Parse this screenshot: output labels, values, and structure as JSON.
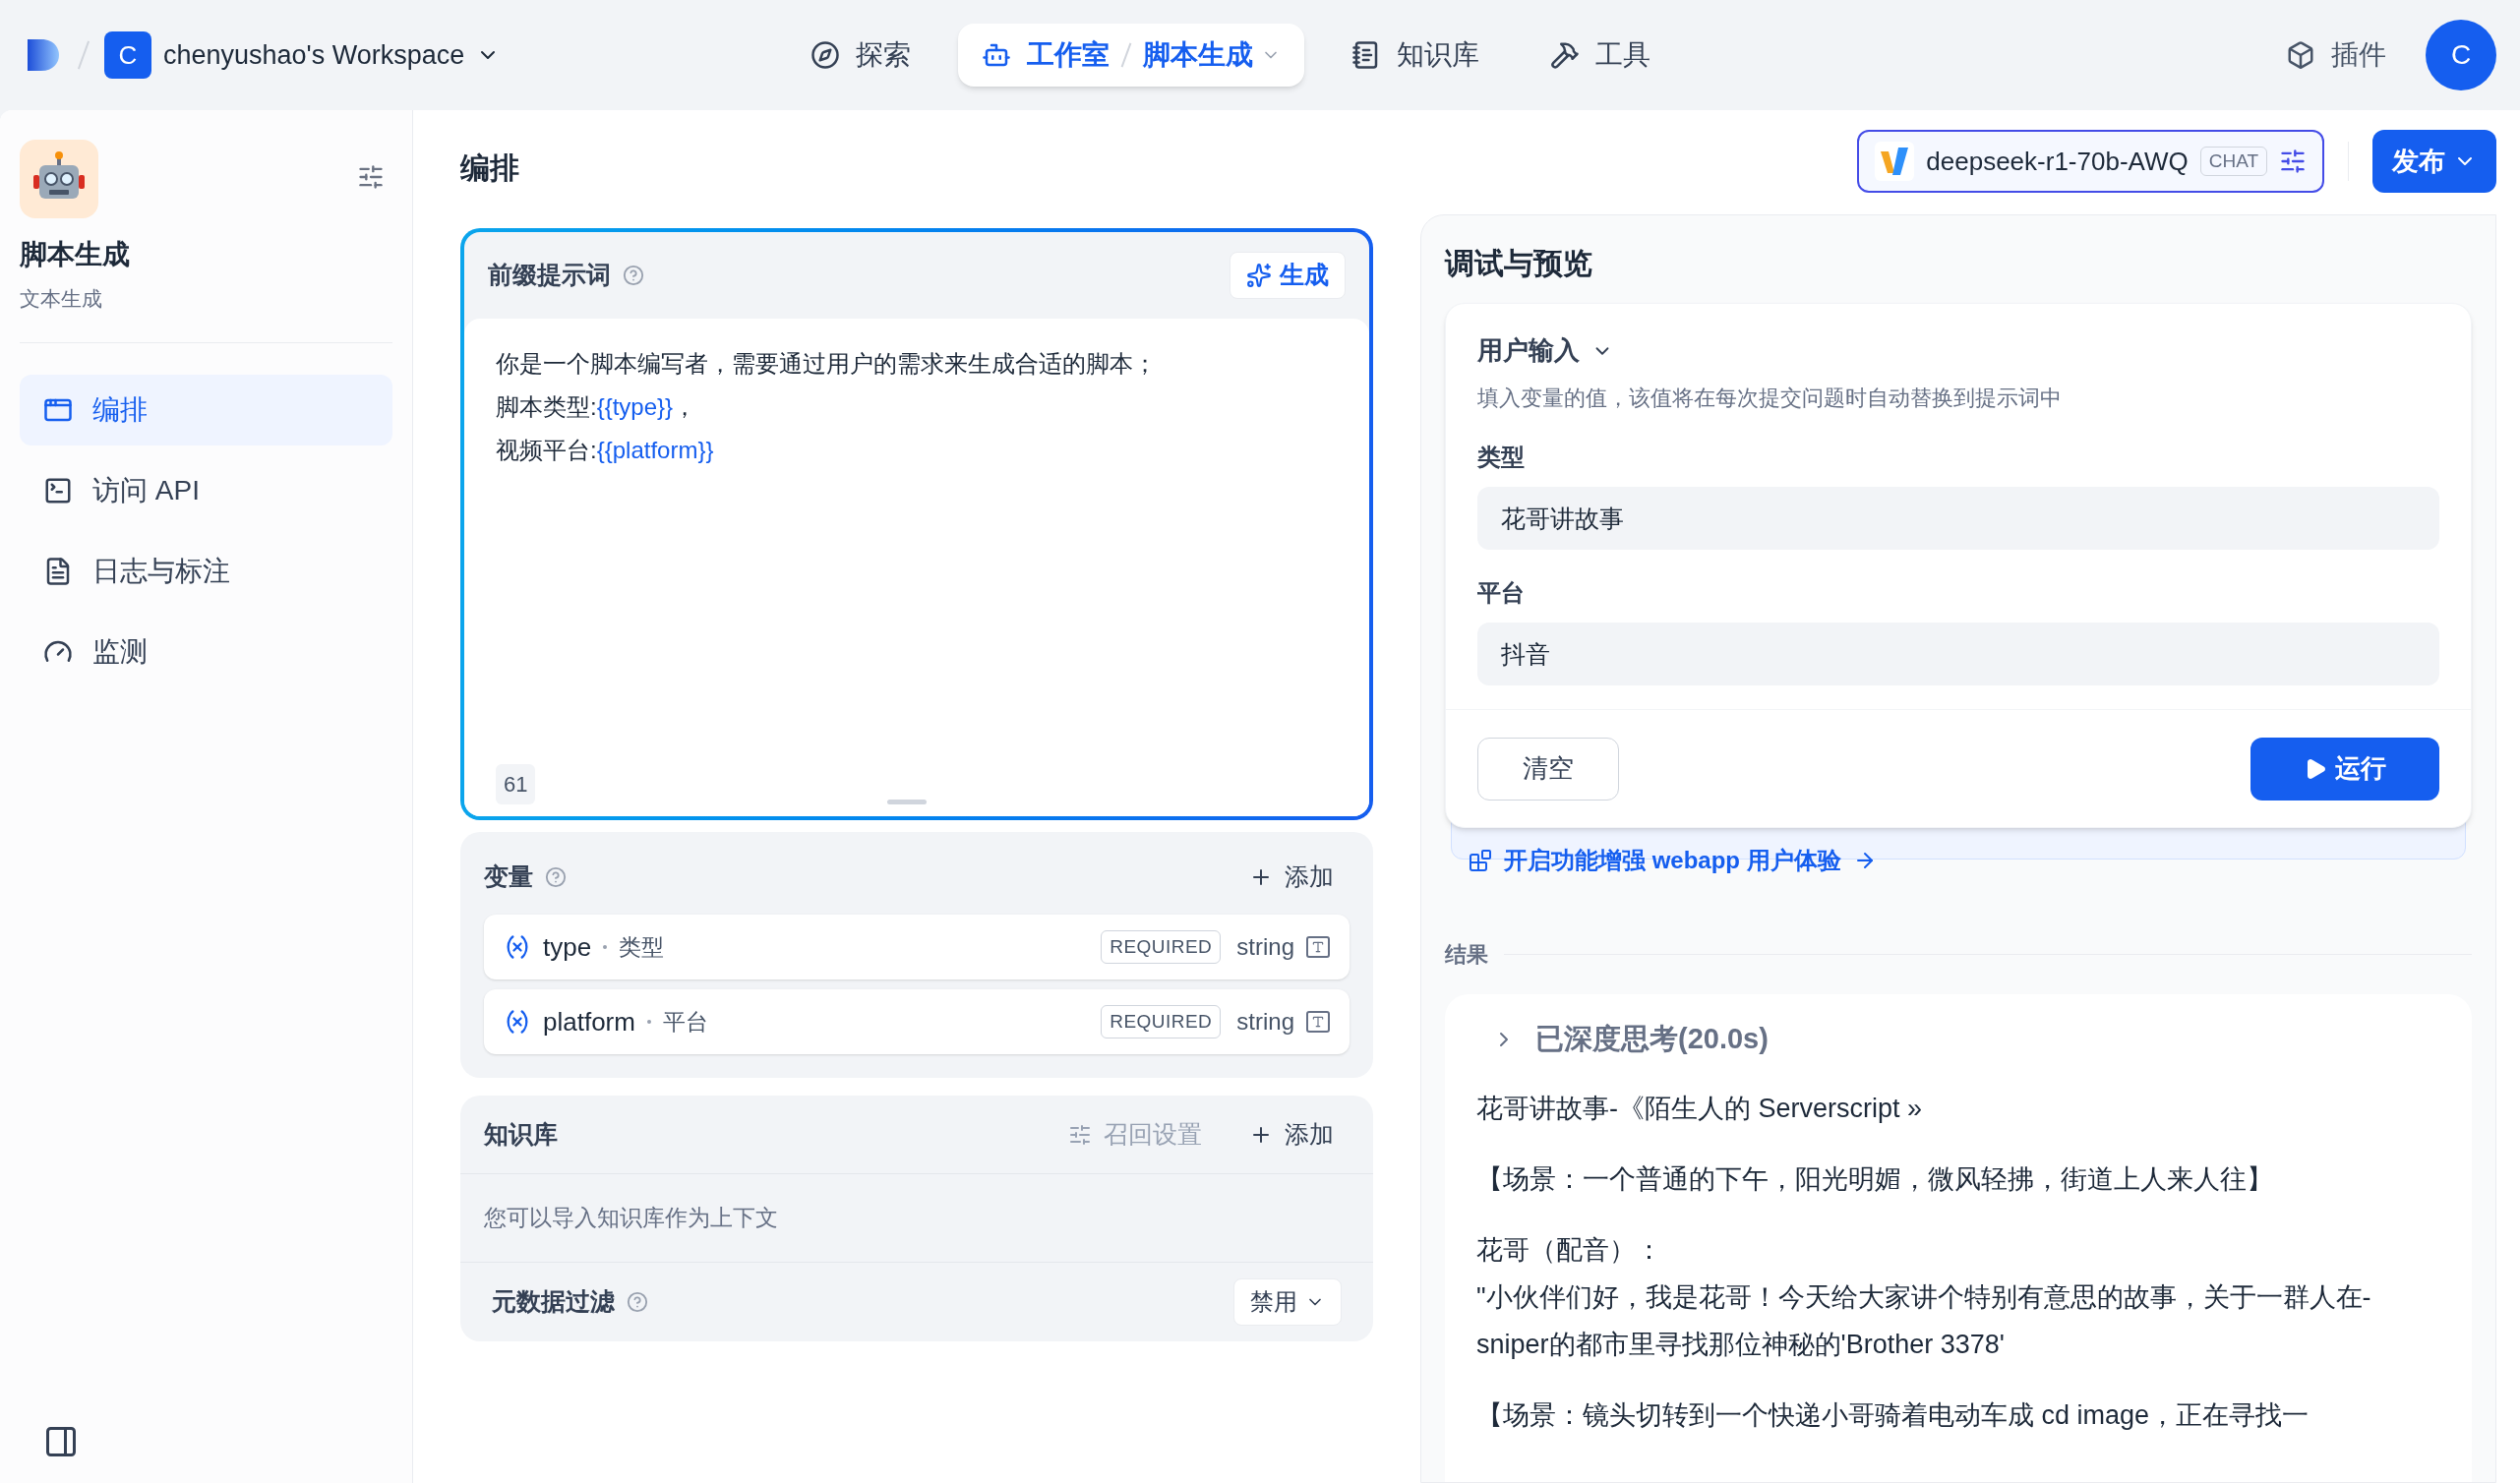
{
  "topbar": {
    "workspace": {
      "initial": "C",
      "name": "chenyushao's Workspace"
    },
    "nav": [
      {
        "kind": "explore",
        "label": "探索",
        "selected": false
      },
      {
        "kind": "studio",
        "label": "工作室",
        "sublabel": "脚本生成",
        "selected": true
      },
      {
        "kind": "knowledge",
        "label": "知识库",
        "selected": false
      },
      {
        "kind": "tools",
        "label": "工具",
        "selected": false
      }
    ],
    "plugins": "插件",
    "avatar": "C"
  },
  "sidebar": {
    "app_name": "脚本生成",
    "app_type": "文本生成",
    "items": [
      {
        "kind": "orchestrate",
        "label": "编排",
        "selected": true
      },
      {
        "kind": "api",
        "label": "访问 API",
        "selected": false
      },
      {
        "kind": "logs",
        "label": "日志与标注",
        "selected": false
      },
      {
        "kind": "monitor",
        "label": "监测",
        "selected": false
      }
    ]
  },
  "editor": {
    "title": "编排",
    "prompt": {
      "title": "前缀提示词",
      "generate": "生成",
      "count": "61",
      "lines": [
        [
          {
            "kind": "text",
            "text": "你是一个脚本编写者，需要通过用户的需求来生成合适的脚本；"
          }
        ],
        [
          {
            "kind": "text",
            "text": "脚本类型:"
          },
          {
            "kind": "var",
            "text": "{{type}}"
          },
          {
            "kind": "text",
            "text": "，"
          }
        ],
        [
          {
            "kind": "text",
            "text": "视频平台:"
          },
          {
            "kind": "var",
            "text": "{{platform}}"
          }
        ]
      ]
    },
    "variables": {
      "title": "变量",
      "add": "添加",
      "items": [
        {
          "name": "type",
          "label": "类型",
          "badge": "REQUIRED",
          "type": "string"
        },
        {
          "name": "platform",
          "label": "平台",
          "badge": "REQUIRED",
          "type": "string"
        }
      ]
    },
    "knowledge": {
      "title": "知识库",
      "recall": {
        "label": "召回设置",
        "disabled": true
      },
      "add": "添加",
      "hint": "您可以导入知识库作为上下文",
      "filter": {
        "label": "元数据过滤",
        "value": "禁用"
      }
    }
  },
  "model": {
    "name": "deepseek-r1-70b-AWQ",
    "mode": "CHAT"
  },
  "publish": "发布",
  "debug": {
    "title": "调试与预览",
    "inputs": {
      "title": "用户输入",
      "hint": "填入变量的值，该值将在每次提交问题时自动替换到提示词中",
      "fields": [
        {
          "label": "类型",
          "value": "花哥讲故事"
        },
        {
          "label": "平台",
          "value": "抖音"
        }
      ],
      "clear": "清空",
      "run": "运行"
    },
    "banner": "开启功能增强 webapp 用户体验",
    "result_label": "结果",
    "result": {
      "thinking": "已深度思考(20.0s)",
      "paragraphs": [
        [
          "花哥讲故事-《陌生人的 Serverscript »"
        ],
        [
          "【场景：一个普通的下午，阳光明媚，微风轻拂，街道上人来人往】"
        ],
        [
          "花哥（配音）：",
          "\"小伙伴们好，我是花哥！今天给大家讲个特别有意思的故事，关于一群人在-sniper的都市里寻找那位神秘的'Brother 3378'"
        ],
        [
          "【场景：镜头切转到一个快递小哥骑着电动车成 cd image，正在寻找一"
        ]
      ]
    }
  }
}
